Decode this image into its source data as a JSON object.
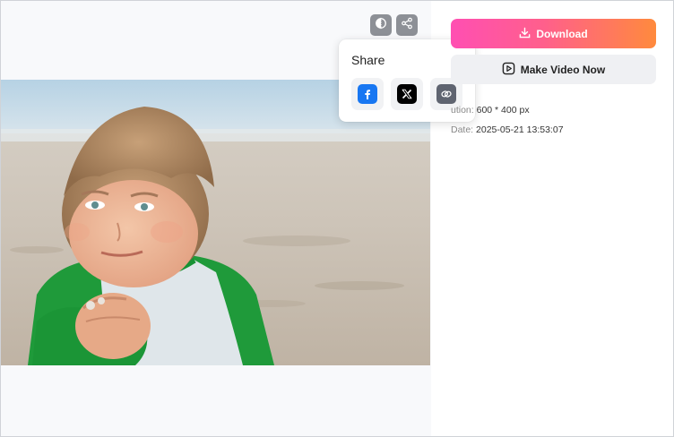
{
  "toolbar": {
    "compare_icon": "compare-icon",
    "share_icon": "share-icon"
  },
  "share_popup": {
    "title": "Share",
    "items": [
      {
        "name": "facebook",
        "icon": "facebook-icon",
        "color": "#1877f2",
        "glyph": "f"
      },
      {
        "name": "x",
        "icon": "x-icon",
        "color": "#000000",
        "glyph": "𝕏"
      },
      {
        "name": "copy-link",
        "icon": "link-icon",
        "color": "#5f6470"
      }
    ]
  },
  "actions": {
    "download_label": "Download",
    "make_video_label": "Make Video Now",
    "accent_start": "#ff4fb2",
    "accent_end": "#ff8a3d"
  },
  "meta": {
    "resolution_key": "ution:",
    "resolution_value": "600 * 400 px",
    "date_key": "Date:",
    "date_value": "2025-05-21 13:53:07"
  }
}
